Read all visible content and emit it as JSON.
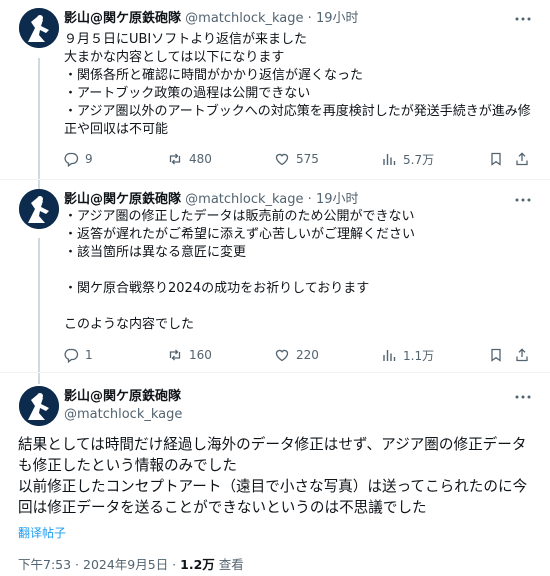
{
  "author": {
    "name": "影山@関ケ原鉄砲隊",
    "handle": "@matchlock_kage"
  },
  "tweets": [
    {
      "separator": "·",
      "time": "19小时",
      "text": "９月５日にUBIソフトより返信が来ました\n大まかな内容としては以下になります\n・関係各所と確認に時間がかかり返信が遅くなった\n・アートブック政策の過程は公開できない\n・アジア圏以外のアートブックへの対応策を再度検討したが発送手続きが進み修正や回収は不可能",
      "replies": "9",
      "reposts": "480",
      "likes": "575",
      "views": "5.7万"
    },
    {
      "separator": "·",
      "time": "19小时",
      "text": "・アジア圏の修正したデータは販売前のため公開ができない\n・返答が遅れたがご希望に添えず心苦しいがご理解ください\n・該当箇所は異なる意匠に変更\n\n・関ケ原合戦祭り2024の成功をお祈りしております\n\nこのような内容でした",
      "replies": "1",
      "reposts": "160",
      "likes": "220",
      "views": "1.1万"
    }
  ],
  "main": {
    "text": "結果としては時間だけ経過し海外のデータ修正はせず、アジア圏の修正データも修正したという情報のみでした\n以前修正したコンセプトアート（遠目で小さな写真）は送ってこられたのに今回は修正データを送ることができないというのは不思議でした",
    "translate": "翻译帖子",
    "timestamp": "下午7:53 · 2024年9月5日 · ",
    "views_count": "1.2万",
    "views_label": " 查看"
  },
  "colors": {
    "text": "#0f1419",
    "secondary": "#536471",
    "link": "#1d9bf0",
    "avatar_bg": "#0d2b4d"
  }
}
